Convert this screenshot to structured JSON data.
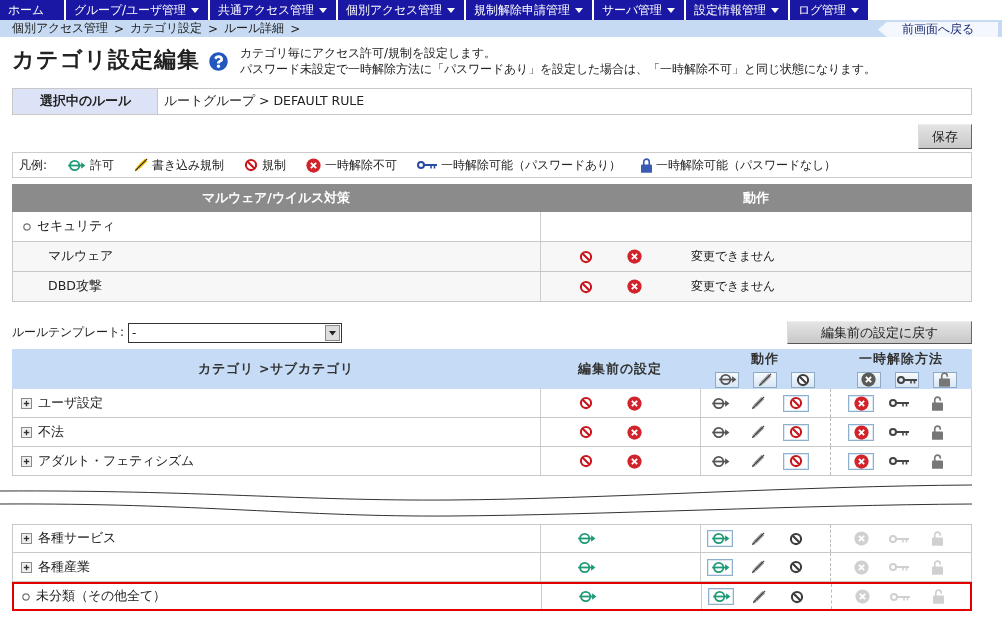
{
  "nav": {
    "items": [
      {
        "label": "ホーム",
        "has_menu": false
      },
      {
        "label": "グループ/ユーザ管理",
        "has_menu": true
      },
      {
        "label": "共通アクセス管理",
        "has_menu": true
      },
      {
        "label": "個別アクセス管理",
        "has_menu": true
      },
      {
        "label": "規制解除申請管理",
        "has_menu": true
      },
      {
        "label": "サーバ管理",
        "has_menu": true
      },
      {
        "label": "設定情報管理",
        "has_menu": true
      },
      {
        "label": "ログ管理",
        "has_menu": true
      }
    ]
  },
  "breadcrumb": {
    "items": [
      "個別アクセス管理",
      "カテゴリ設定",
      "ルール詳細"
    ],
    "separator": ">",
    "back_link": "前画面へ戻る"
  },
  "header": {
    "title": "カテゴリ設定編集",
    "description": [
      "カテゴリ毎にアクセス許可/規制を設定します。",
      "パスワード未設定で一時解除方法に「パスワードあり」を設定した場合は、「一時解除不可」と同じ状態になります。"
    ]
  },
  "selected_rule": {
    "label": "選択中のルール",
    "value": "ルートグループ > DEFAULT RULE"
  },
  "save_button": "保存",
  "legend": {
    "title": "凡例:",
    "items": [
      {
        "kind": "allow",
        "label": "許可"
      },
      {
        "kind": "write_block",
        "label": "書き込み規制"
      },
      {
        "kind": "block",
        "label": "規制"
      },
      {
        "kind": "no_release",
        "label": "一時解除不可"
      },
      {
        "kind": "password_release",
        "label": "一時解除可能（パスワードあり）"
      },
      {
        "kind": "free_release",
        "label": "一時解除可能（パスワードなし）"
      }
    ]
  },
  "malware_table": {
    "columns": [
      "マルウェア/ウイルス対策",
      "動作"
    ],
    "rows": [
      {
        "label": "セキュリティ",
        "children": [
          {
            "label": "マルウェア",
            "actions": [
              {
                "kind": "block"
              },
              {
                "kind": "no_release"
              }
            ],
            "note": "変更できません"
          },
          {
            "label": "DBD攻撃",
            "actions": [
              {
                "kind": "block"
              },
              {
                "kind": "no_release"
              }
            ],
            "note": "変更できません"
          }
        ]
      }
    ]
  },
  "template": {
    "label": "ルールテンプレート:",
    "value": "-"
  },
  "revert_button": "編集前の設定に戻す",
  "category_table": {
    "columns": [
      {
        "label": "カテゴリ >サブカテゴリ"
      },
      {
        "label": "編集前の設定"
      },
      {
        "label": "動作",
        "buttons": [
          {
            "kind": "allow"
          },
          {
            "kind": "write_block"
          },
          {
            "kind": "block"
          }
        ]
      },
      {
        "label": "一時解除方法",
        "buttons": [
          {
            "kind": "no_release"
          },
          {
            "kind": "password_release"
          },
          {
            "kind": "free_release"
          }
        ]
      }
    ],
    "sections": [
      {
        "rows": [
          {
            "label": "ユーザ設定",
            "kind": "collapsed",
            "highlighted": false,
            "before": [
              {
                "kind": "block"
              },
              {
                "kind": "no_release"
              }
            ],
            "actions": [
              {
                "kind": "allow",
                "selected": false
              },
              {
                "kind": "write_block",
                "selected": false
              },
              {
                "kind": "block",
                "selected": true
              }
            ],
            "release": [
              {
                "kind": "no_release",
                "selected": true,
                "disabled": false
              },
              {
                "kind": "password_release",
                "selected": false,
                "disabled": false
              },
              {
                "kind": "free_release",
                "selected": false,
                "disabled": false
              }
            ]
          },
          {
            "label": "不法",
            "kind": "collapsed",
            "highlighted": false,
            "before": [
              {
                "kind": "block"
              },
              {
                "kind": "no_release"
              }
            ],
            "actions": [
              {
                "kind": "allow",
                "selected": false
              },
              {
                "kind": "write_block",
                "selected": false
              },
              {
                "kind": "block",
                "selected": true
              }
            ],
            "release": [
              {
                "kind": "no_release",
                "selected": true,
                "disabled": false
              },
              {
                "kind": "password_release",
                "selected": false,
                "disabled": false
              },
              {
                "kind": "free_release",
                "selected": false,
                "disabled": false
              }
            ]
          },
          {
            "label": "アダルト・フェティシズム",
            "kind": "collapsed",
            "highlighted": false,
            "before": [
              {
                "kind": "block"
              },
              {
                "kind": "no_release"
              }
            ],
            "actions": [
              {
                "kind": "allow",
                "selected": false
              },
              {
                "kind": "write_block",
                "selected": false
              },
              {
                "kind": "block",
                "selected": true
              }
            ],
            "release": [
              {
                "kind": "no_release",
                "selected": true,
                "disabled": false
              },
              {
                "kind": "password_release",
                "selected": false,
                "disabled": false
              },
              {
                "kind": "free_release",
                "selected": false,
                "disabled": false
              }
            ]
          }
        ]
      },
      {
        "rows": [
          {
            "label": "各種サービス",
            "kind": "collapsed",
            "highlighted": false,
            "before": [
              {
                "kind": "allow"
              }
            ],
            "actions": [
              {
                "kind": "allow",
                "selected": true
              },
              {
                "kind": "write_block",
                "selected": false
              },
              {
                "kind": "block",
                "selected": false
              }
            ],
            "release": [
              {
                "kind": "no_release",
                "selected": false,
                "disabled": true
              },
              {
                "kind": "password_release",
                "selected": false,
                "disabled": true
              },
              {
                "kind": "free_release",
                "selected": false,
                "disabled": true
              }
            ]
          },
          {
            "label": "各種産業",
            "kind": "collapsed",
            "highlighted": false,
            "before": [
              {
                "kind": "allow"
              }
            ],
            "actions": [
              {
                "kind": "allow",
                "selected": true
              },
              {
                "kind": "write_block",
                "selected": false
              },
              {
                "kind": "block",
                "selected": false
              }
            ],
            "release": [
              {
                "kind": "no_release",
                "selected": false,
                "disabled": true
              },
              {
                "kind": "password_release",
                "selected": false,
                "disabled": true
              },
              {
                "kind": "free_release",
                "selected": false,
                "disabled": true
              }
            ]
          },
          {
            "label": "未分類（その他全て）",
            "kind": "leaf",
            "highlighted": true,
            "before": [
              {
                "kind": "allow"
              }
            ],
            "actions": [
              {
                "kind": "allow",
                "selected": true
              },
              {
                "kind": "write_block",
                "selected": false
              },
              {
                "kind": "block",
                "selected": false
              }
            ],
            "release": [
              {
                "kind": "no_release",
                "selected": false,
                "disabled": true
              },
              {
                "kind": "password_release",
                "selected": false,
                "disabled": true
              },
              {
                "kind": "free_release",
                "selected": false,
                "disabled": true
              }
            ]
          }
        ]
      }
    ]
  }
}
